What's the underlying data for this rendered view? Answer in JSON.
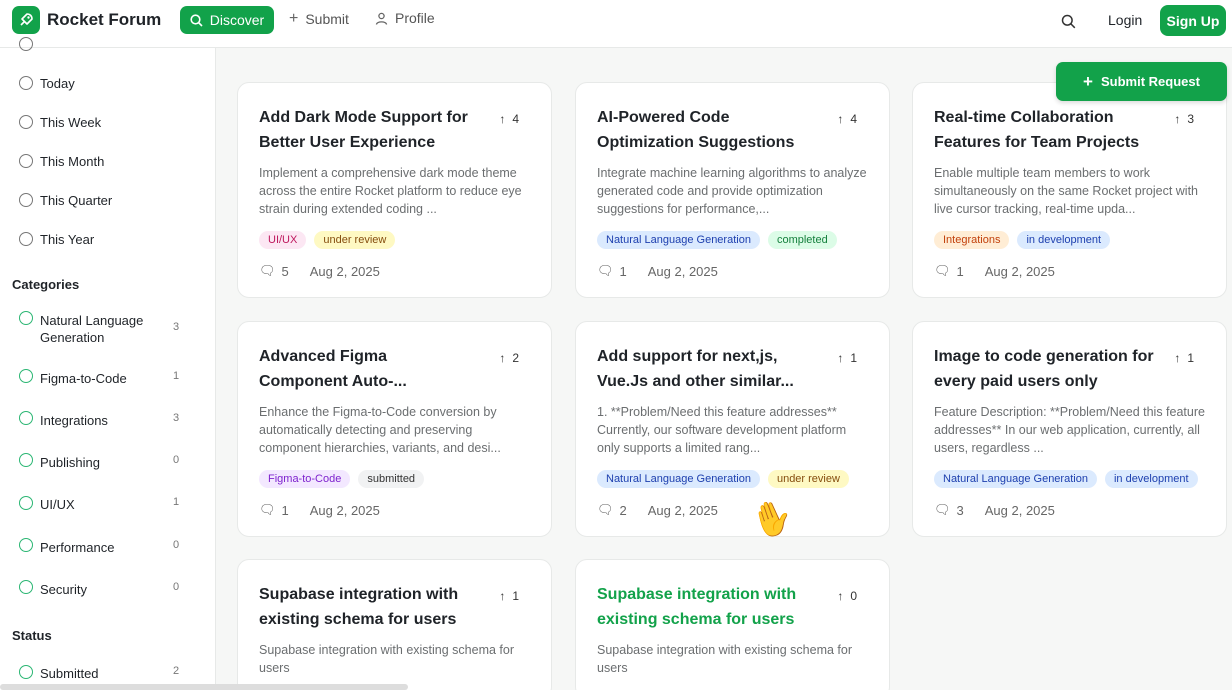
{
  "header": {
    "brand": "Rocket Forum",
    "logo_icon": "rocket-icon",
    "nav": {
      "discover": "Discover",
      "submit": "Submit",
      "profile": "Profile"
    },
    "login": "Login",
    "signup": "Sign Up"
  },
  "sidebar": {
    "time_filters": [
      "Today",
      "This Week",
      "This Month",
      "This Quarter",
      "This Year"
    ],
    "categories_title": "Categories",
    "categories": [
      {
        "label": "Natural Language Generation",
        "count": "3"
      },
      {
        "label": "Figma-to-Code",
        "count": "1"
      },
      {
        "label": "Integrations",
        "count": "3"
      },
      {
        "label": "Publishing",
        "count": "0"
      },
      {
        "label": "UI/UX",
        "count": "1"
      },
      {
        "label": "Performance",
        "count": "0"
      },
      {
        "label": "Security",
        "count": "0"
      }
    ],
    "status_title": "Status",
    "statuses": [
      {
        "label": "Submitted",
        "count": "2"
      }
    ]
  },
  "submit_request": "Submit Request",
  "cards": [
    {
      "title": "Add Dark Mode Support for Better User Experience",
      "votes": "4",
      "description": "Implement a comprehensive dark mode theme across the entire Rocket platform to reduce eye strain during extended coding ...",
      "tags": [
        "UI/UX",
        "under review"
      ],
      "comments": "5",
      "date": "Aug 2, 2025"
    },
    {
      "title": "AI-Powered Code Optimization Suggestions",
      "votes": "4",
      "description": "Integrate machine learning algorithms to analyze generated code and provide optimization suggestions for performance,...",
      "tags": [
        "Natural Language Generation",
        "completed"
      ],
      "comments": "1",
      "date": "Aug 2, 2025"
    },
    {
      "title": "Real-time Collaboration Features for Team Projects",
      "votes": "3",
      "description": "Enable multiple team members to work simultaneously on the same Rocket project with live cursor tracking, real-time upda...",
      "tags": [
        "Integrations",
        "in development"
      ],
      "comments": "1",
      "date": "Aug 2, 2025"
    },
    {
      "title": "Advanced Figma Component Auto-...",
      "votes": "2",
      "description": "Enhance the Figma-to-Code conversion by automatically detecting and preserving component hierarchies, variants, and desi...",
      "tags": [
        "Figma-to-Code",
        "submitted"
      ],
      "comments": "1",
      "date": "Aug 2, 2025"
    },
    {
      "title": "Add support for next,js, Vue.Js and other similar...",
      "votes": "1",
      "description": "1. **Problem/Need this feature addresses** Currently, our software development platform only supports a limited rang...",
      "tags": [
        "Natural Language Generation",
        "under review"
      ],
      "comments": "2",
      "date": "Aug 2, 2025"
    },
    {
      "title": "Image to code generation for every paid users only",
      "votes": "1",
      "description": "Feature Description: **Problem/Need this feature addresses** In our web application, currently, all users, regardless ...",
      "tags": [
        "Natural Language Generation",
        "in development"
      ],
      "comments": "3",
      "date": "Aug 2, 2025"
    },
    {
      "title": "Supabase integration with existing schema for users",
      "votes": "1",
      "description": "Supabase integration with existing schema for users",
      "tags": [],
      "comments": "",
      "date": ""
    },
    {
      "title": "Supabase integration with existing schema for users",
      "votes": "0",
      "description": "Supabase integration with existing schema for users",
      "tags": [],
      "comments": "",
      "date": ""
    }
  ],
  "colors": {
    "accent": "#12a24a"
  }
}
